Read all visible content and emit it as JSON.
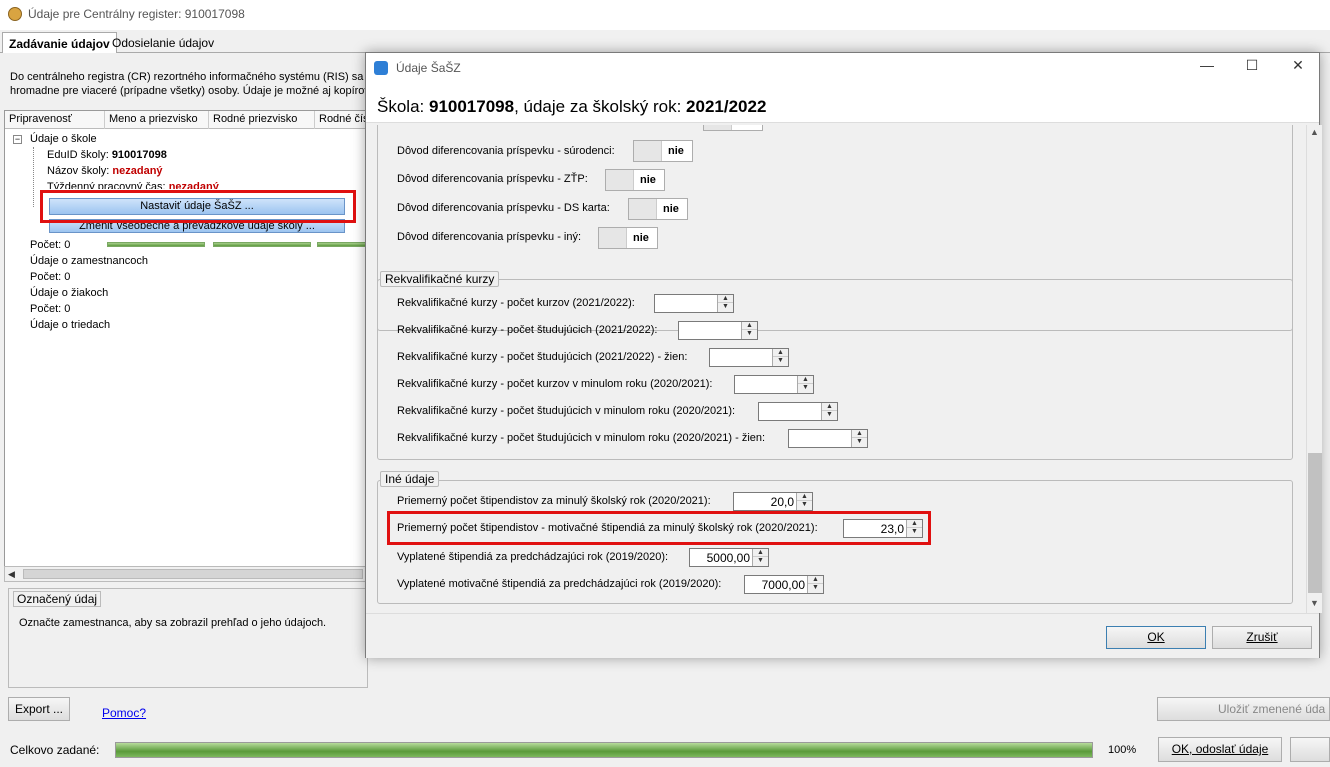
{
  "window": {
    "title": "Údaje pre Centrálny register: 910017098"
  },
  "tabs": [
    "Zadávanie údajov",
    "Odosielanie údajov"
  ],
  "description": [
    "Do centrálneho registra (CR) rezortného informačného systému (RIS) sa",
    "hromadne pre viaceré (prípadne všetky) osoby. Údaje je možné aj kopírov"
  ],
  "grid": {
    "columns": [
      "Pripravenosť",
      "Meno a priezvisko",
      "Rodné priezvisko",
      "Rodné čís"
    ],
    "tree": {
      "root": "Údaje o škole",
      "eduid_label": "EduID školy:",
      "eduid_value": "910017098",
      "name_label": "Názov školy:",
      "name_value": "nezadaný",
      "hours_label": "Týždenný pracovný čas:",
      "hours_value": "nezadaný",
      "btn_sasz": "Nastaviť údaje ŠaŠZ ...",
      "btn_general": "Zmeniť všeobecné a prevádzkové údaje školy ...",
      "items": [
        "Počet: 0",
        "Údaje o zamestnancoch",
        "Počet: 0",
        "Údaje o žiakoch",
        "Počet: 0",
        "Údaje o triedach"
      ]
    }
  },
  "selected": {
    "label": "Označený údaj",
    "message": "Označte zamestnanca, aby sa zobrazil prehľad o jeho údajoch."
  },
  "footer": {
    "export": "Export ...",
    "help": "Pomoc?",
    "save": "Uložiť zmenené úda",
    "total_label": "Celkovo zadané:",
    "total_pct": "100%",
    "total_progress": 1.0,
    "ok_send": "OK, odoslať údaje"
  },
  "dialog": {
    "title": "Údaje ŠaŠZ",
    "head_prefix": "Škola: ",
    "head_id": "910017098",
    "head_mid": ", údaje za školský rok: ",
    "head_year": "2021/2022",
    "toggle_partial": "nie",
    "toggles": [
      {
        "label": "Dôvod diferencovania príspevku - súrodenci:",
        "value": "nie"
      },
      {
        "label": "Dôvod diferencovania príspevku - ZŤP:",
        "value": "nie"
      },
      {
        "label": "Dôvod diferencovania príspevku - DS karta:",
        "value": "nie"
      },
      {
        "label": "Dôvod diferencovania príspevku - iný:",
        "value": "nie"
      }
    ],
    "rekv": {
      "legend": "Rekvalifikačné kurzy",
      "rows": [
        {
          "label": "Rekvalifikačné kurzy - počet kurzov (2021/2022):",
          "value": ""
        },
        {
          "label": "Rekvalifikačné kurzy - počet študujúcich (2021/2022):",
          "value": ""
        },
        {
          "label": "Rekvalifikačné kurzy - počet študujúcich (2021/2022) - žien:",
          "value": ""
        },
        {
          "label": "Rekvalifikačné kurzy - počet kurzov v minulom roku (2020/2021):",
          "value": ""
        },
        {
          "label": "Rekvalifikačné kurzy - počet študujúcich v minulom roku (2020/2021):",
          "value": ""
        },
        {
          "label": "Rekvalifikačné kurzy - počet študujúcich v minulom roku (2020/2021) - žien:",
          "value": ""
        }
      ]
    },
    "ine": {
      "legend": "Iné údaje",
      "rows": [
        {
          "label": "Priemerný počet štipendistov za minulý školský rok (2020/2021):",
          "value": "20,0"
        },
        {
          "label": "Priemerný počet štipendistov - motivačné štipendiá za minulý školský rok (2020/2021):",
          "value": "23,0"
        },
        {
          "label": "Vyplatené štipendiá za predchádzajúci rok (2019/2020):",
          "value": "5000,00"
        },
        {
          "label": "Vyplatené motivačné štipendiá za predchádzajúci rok (2019/2020):",
          "value": "7000,00"
        }
      ]
    },
    "ok": "OK",
    "cancel": "Zrušiť"
  },
  "colors": {
    "highlight": "#e01010",
    "progress": "#5e9a3e"
  }
}
